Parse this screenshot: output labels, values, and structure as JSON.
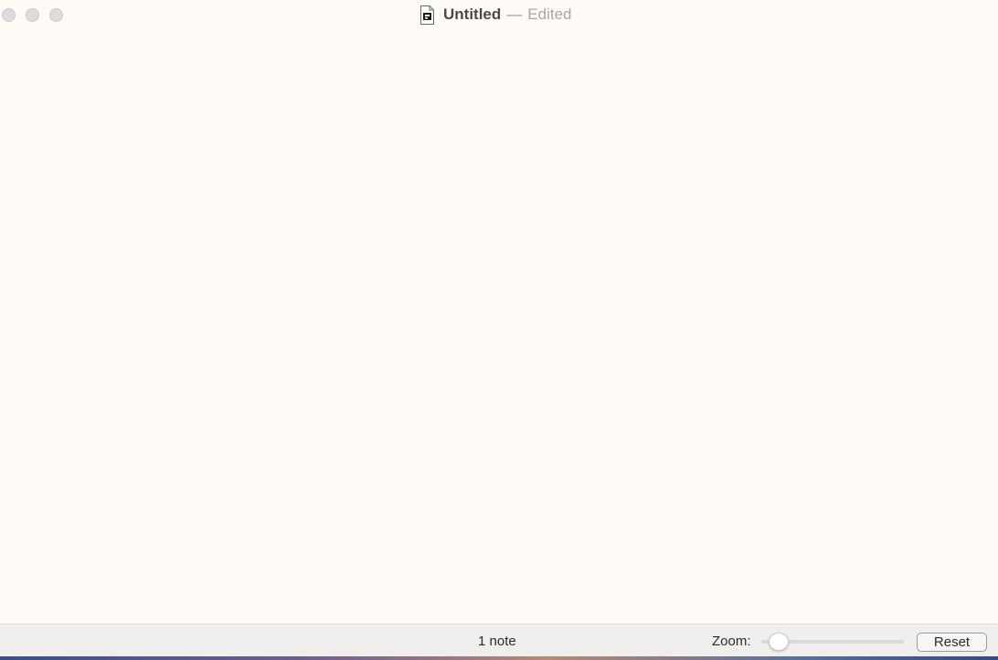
{
  "window": {
    "title": "Untitled",
    "separator": "—",
    "status": "Edited",
    "doc_icon": "document-icon"
  },
  "canvas": {
    "background": "#fffcf7"
  },
  "statusbar": {
    "note_count": "1 note",
    "zoom_label": "Zoom:",
    "zoom_level": 0.12,
    "reset_label": "Reset"
  }
}
